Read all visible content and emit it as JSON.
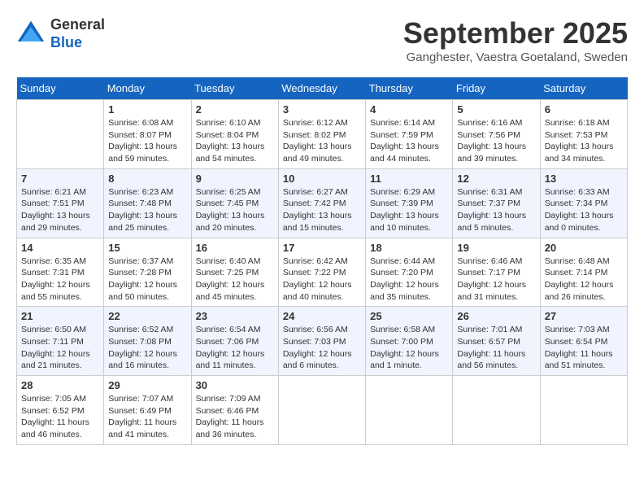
{
  "header": {
    "logo_line1": "General",
    "logo_line2": "Blue",
    "month": "September 2025",
    "location": "Ganghester, Vaestra Goetaland, Sweden"
  },
  "weekdays": [
    "Sunday",
    "Monday",
    "Tuesday",
    "Wednesday",
    "Thursday",
    "Friday",
    "Saturday"
  ],
  "weeks": [
    [
      {
        "day": "",
        "data": ""
      },
      {
        "day": "1",
        "data": "Sunrise: 6:08 AM\nSunset: 8:07 PM\nDaylight: 13 hours\nand 59 minutes."
      },
      {
        "day": "2",
        "data": "Sunrise: 6:10 AM\nSunset: 8:04 PM\nDaylight: 13 hours\nand 54 minutes."
      },
      {
        "day": "3",
        "data": "Sunrise: 6:12 AM\nSunset: 8:02 PM\nDaylight: 13 hours\nand 49 minutes."
      },
      {
        "day": "4",
        "data": "Sunrise: 6:14 AM\nSunset: 7:59 PM\nDaylight: 13 hours\nand 44 minutes."
      },
      {
        "day": "5",
        "data": "Sunrise: 6:16 AM\nSunset: 7:56 PM\nDaylight: 13 hours\nand 39 minutes."
      },
      {
        "day": "6",
        "data": "Sunrise: 6:18 AM\nSunset: 7:53 PM\nDaylight: 13 hours\nand 34 minutes."
      }
    ],
    [
      {
        "day": "7",
        "data": "Sunrise: 6:21 AM\nSunset: 7:51 PM\nDaylight: 13 hours\nand 29 minutes."
      },
      {
        "day": "8",
        "data": "Sunrise: 6:23 AM\nSunset: 7:48 PM\nDaylight: 13 hours\nand 25 minutes."
      },
      {
        "day": "9",
        "data": "Sunrise: 6:25 AM\nSunset: 7:45 PM\nDaylight: 13 hours\nand 20 minutes."
      },
      {
        "day": "10",
        "data": "Sunrise: 6:27 AM\nSunset: 7:42 PM\nDaylight: 13 hours\nand 15 minutes."
      },
      {
        "day": "11",
        "data": "Sunrise: 6:29 AM\nSunset: 7:39 PM\nDaylight: 13 hours\nand 10 minutes."
      },
      {
        "day": "12",
        "data": "Sunrise: 6:31 AM\nSunset: 7:37 PM\nDaylight: 13 hours\nand 5 minutes."
      },
      {
        "day": "13",
        "data": "Sunrise: 6:33 AM\nSunset: 7:34 PM\nDaylight: 13 hours\nand 0 minutes."
      }
    ],
    [
      {
        "day": "14",
        "data": "Sunrise: 6:35 AM\nSunset: 7:31 PM\nDaylight: 12 hours\nand 55 minutes."
      },
      {
        "day": "15",
        "data": "Sunrise: 6:37 AM\nSunset: 7:28 PM\nDaylight: 12 hours\nand 50 minutes."
      },
      {
        "day": "16",
        "data": "Sunrise: 6:40 AM\nSunset: 7:25 PM\nDaylight: 12 hours\nand 45 minutes."
      },
      {
        "day": "17",
        "data": "Sunrise: 6:42 AM\nSunset: 7:22 PM\nDaylight: 12 hours\nand 40 minutes."
      },
      {
        "day": "18",
        "data": "Sunrise: 6:44 AM\nSunset: 7:20 PM\nDaylight: 12 hours\nand 35 minutes."
      },
      {
        "day": "19",
        "data": "Sunrise: 6:46 AM\nSunset: 7:17 PM\nDaylight: 12 hours\nand 31 minutes."
      },
      {
        "day": "20",
        "data": "Sunrise: 6:48 AM\nSunset: 7:14 PM\nDaylight: 12 hours\nand 26 minutes."
      }
    ],
    [
      {
        "day": "21",
        "data": "Sunrise: 6:50 AM\nSunset: 7:11 PM\nDaylight: 12 hours\nand 21 minutes."
      },
      {
        "day": "22",
        "data": "Sunrise: 6:52 AM\nSunset: 7:08 PM\nDaylight: 12 hours\nand 16 minutes."
      },
      {
        "day": "23",
        "data": "Sunrise: 6:54 AM\nSunset: 7:06 PM\nDaylight: 12 hours\nand 11 minutes."
      },
      {
        "day": "24",
        "data": "Sunrise: 6:56 AM\nSunset: 7:03 PM\nDaylight: 12 hours\nand 6 minutes."
      },
      {
        "day": "25",
        "data": "Sunrise: 6:58 AM\nSunset: 7:00 PM\nDaylight: 12 hours\nand 1 minute."
      },
      {
        "day": "26",
        "data": "Sunrise: 7:01 AM\nSunset: 6:57 PM\nDaylight: 11 hours\nand 56 minutes."
      },
      {
        "day": "27",
        "data": "Sunrise: 7:03 AM\nSunset: 6:54 PM\nDaylight: 11 hours\nand 51 minutes."
      }
    ],
    [
      {
        "day": "28",
        "data": "Sunrise: 7:05 AM\nSunset: 6:52 PM\nDaylight: 11 hours\nand 46 minutes."
      },
      {
        "day": "29",
        "data": "Sunrise: 7:07 AM\nSunset: 6:49 PM\nDaylight: 11 hours\nand 41 minutes."
      },
      {
        "day": "30",
        "data": "Sunrise: 7:09 AM\nSunset: 6:46 PM\nDaylight: 11 hours\nand 36 minutes."
      },
      {
        "day": "",
        "data": ""
      },
      {
        "day": "",
        "data": ""
      },
      {
        "day": "",
        "data": ""
      },
      {
        "day": "",
        "data": ""
      }
    ]
  ]
}
